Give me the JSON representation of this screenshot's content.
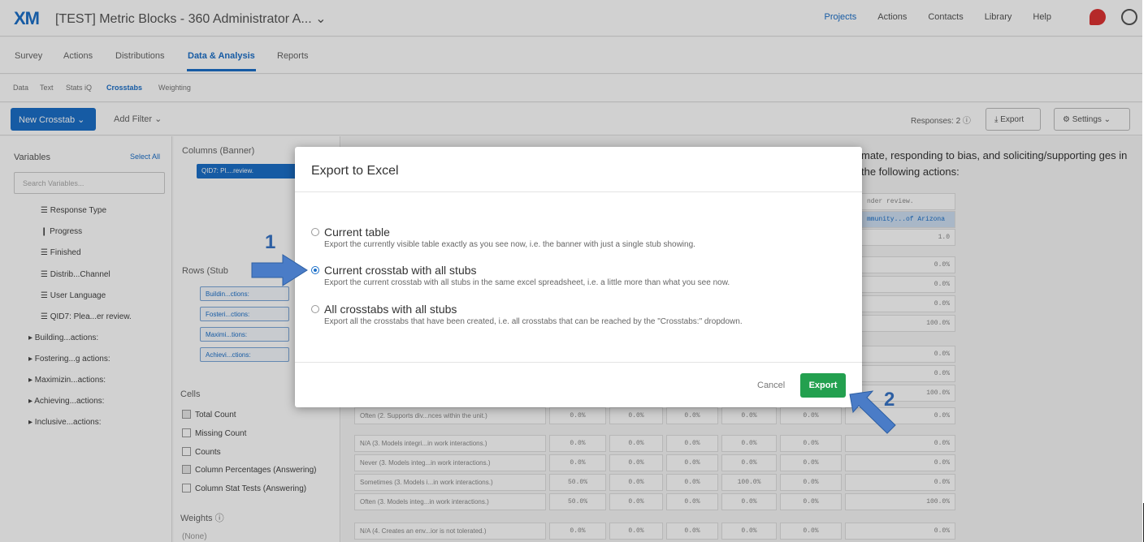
{
  "header": {
    "logo": "XM",
    "project_title": "[TEST] Metric Blocks - 360 Administrator A... ⌄",
    "nav": [
      "Projects",
      "Actions",
      "Contacts",
      "Library",
      "Help"
    ]
  },
  "tabs": [
    "Survey",
    "Actions",
    "Distributions",
    "Data & Analysis",
    "Reports"
  ],
  "subtabs": [
    "Data",
    "Text",
    "Stats iQ",
    "Crosstabs",
    "Weighting"
  ],
  "toolbar": {
    "new_crosstab": "New Crosstab ⌄",
    "add_filter": "Add Filter ⌄",
    "responses": "Responses: 2 ⓘ",
    "export": "⤓ Export",
    "settings": "⚙ Settings ⌄"
  },
  "variables": {
    "heading": "Variables",
    "select_all": "Select All",
    "search_placeholder": "Search Variables...",
    "items": [
      "☰ Response Type",
      "❙ Progress",
      "☰ Finished",
      "☰ Distrib...Channel",
      "☰ User Language",
      "☰ QID7: Plea...er review."
    ],
    "groups": [
      "▸ Building...actions:",
      "▸ Fostering...g actions:",
      "▸ Maximizin...actions:",
      "▸ Achieving...actions:",
      "▸ Inclusive...actions:"
    ]
  },
  "columns_panel": {
    "heading": "Columns (Banner)",
    "chip": "QID7: Pl....review."
  },
  "rows_panel": {
    "heading": "Rows (Stub",
    "chips": [
      "Buildin...ctions:",
      "Fosteri...ctions:",
      "Maximi...tions:",
      "Achievi...ctions:"
    ]
  },
  "cells_panel": {
    "heading": "Cells",
    "options": [
      {
        "label": "Total Count",
        "checked": true
      },
      {
        "label": "Missing Count",
        "checked": false
      },
      {
        "label": "Counts",
        "checked": false
      },
      {
        "label": "Column Percentages (Answering)",
        "checked": true
      },
      {
        "label": "Column Stat Tests (Answering)",
        "checked": false
      }
    ],
    "weights": "Weights ⓘ",
    "weights_value": "(None)"
  },
  "summary_text": "mate, responding to bias, and soliciting/supporting ges in the following actions:",
  "table": {
    "header_cells": [
      "nder review.",
      "mmunity...of Arizona",
      "1.0"
    ],
    "right_values": [
      "0.0%",
      "0.0%",
      "0.0%",
      "100.0%",
      "0.0%",
      "0.0%",
      "100.0%",
      "0.0%"
    ],
    "rows": [
      {
        "label": "Often (2. Supports div...nces within the unit.)",
        "values": [
          "0.0%",
          "0.0%",
          "0.0%",
          "0.0%",
          "0.0%",
          "0.0%"
        ]
      },
      {
        "label": "N/A (3. Models integri...in work interactions.)",
        "values": [
          "0.0%",
          "0.0%",
          "0.0%",
          "0.0%",
          "0.0%",
          "0.0%"
        ]
      },
      {
        "label": "Never (3. Models integ...in work interactions.)",
        "values": [
          "0.0%",
          "0.0%",
          "0.0%",
          "0.0%",
          "0.0%",
          "0.0%"
        ]
      },
      {
        "label": "Sometimes (3. Models i...in work interactions.)",
        "values": [
          "50.0%",
          "0.0%",
          "0.0%",
          "100.0%",
          "0.0%",
          "0.0%"
        ]
      },
      {
        "label": "Often (3. Models integ...in work interactions.)",
        "values": [
          "50.0%",
          "0.0%",
          "0.0%",
          "0.0%",
          "0.0%",
          "100.0%"
        ]
      },
      {
        "label": "N/A (4. Creates an env...ior is not tolerated.)",
        "values": [
          "0.0%",
          "0.0%",
          "0.0%",
          "0.0%",
          "0.0%",
          "0.0%"
        ]
      }
    ]
  },
  "modal": {
    "title": "Export to Excel",
    "options": [
      {
        "label": "Current table",
        "desc": "Export the currently visible table exactly as you see now, i.e. the banner with just a single stub showing.",
        "selected": false
      },
      {
        "label": "Current crosstab with all stubs",
        "desc": "Export the current crosstab with all stubs in the same excel spreadsheet, i.e. a little more than what you see now.",
        "selected": true
      },
      {
        "label": "All crosstabs with all stubs",
        "desc": "Export all the crosstabs that have been created, i.e. all crosstabs that can be reached by the \"Crosstabs:\" dropdown.",
        "selected": false
      }
    ],
    "cancel": "Cancel",
    "export": "Export"
  },
  "annotations": {
    "step1": "1",
    "step2": "2",
    "arrow_color": "#4a7cc7"
  },
  "colors": {
    "accent": "#1b6fc8",
    "export_green": "#23a04f"
  }
}
